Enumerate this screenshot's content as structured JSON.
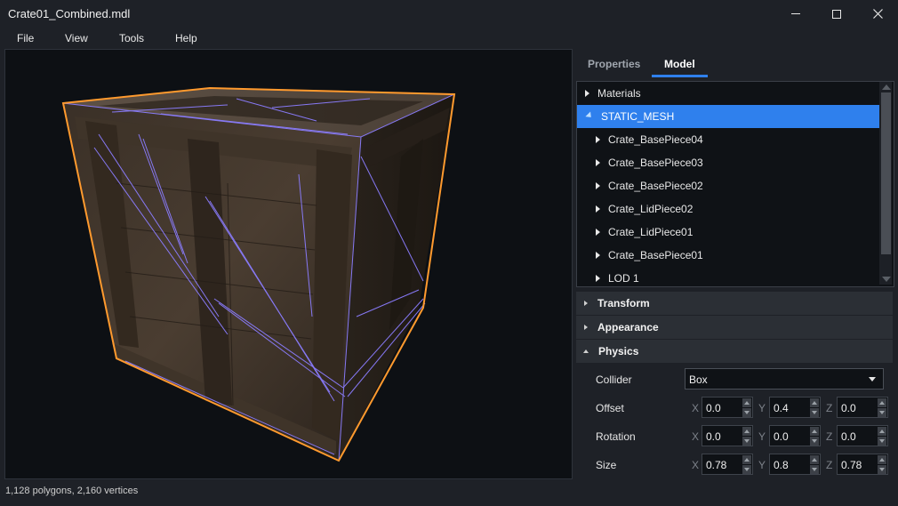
{
  "window": {
    "title": "Crate01_Combined.mdl"
  },
  "menu": [
    "File",
    "View",
    "Tools",
    "Help"
  ],
  "tabs": [
    {
      "label": "Properties",
      "active": false
    },
    {
      "label": "Model",
      "active": true
    }
  ],
  "tree": {
    "items": [
      {
        "label": "Materials",
        "level": 0,
        "expanded": false,
        "selected": false
      },
      {
        "label": "STATIC_MESH",
        "level": 0,
        "expanded": true,
        "selected": true
      },
      {
        "label": "Crate_BasePiece04",
        "level": 1,
        "expanded": false,
        "selected": false
      },
      {
        "label": "Crate_BasePiece03",
        "level": 1,
        "expanded": false,
        "selected": false
      },
      {
        "label": "Crate_BasePiece02",
        "level": 1,
        "expanded": false,
        "selected": false
      },
      {
        "label": "Crate_LidPiece02",
        "level": 1,
        "expanded": false,
        "selected": false
      },
      {
        "label": "Crate_LidPiece01",
        "level": 1,
        "expanded": false,
        "selected": false
      },
      {
        "label": "Crate_BasePiece01",
        "level": 1,
        "expanded": false,
        "selected": false
      },
      {
        "label": "LOD 1",
        "level": 1,
        "expanded": false,
        "selected": false
      }
    ]
  },
  "sections": {
    "transform": {
      "label": "Transform",
      "expanded": false
    },
    "appearance": {
      "label": "Appearance",
      "expanded": false
    },
    "physics": {
      "label": "Physics",
      "expanded": true
    }
  },
  "physics": {
    "collider": {
      "label": "Collider",
      "value": "Box"
    },
    "axes": {
      "x": "X",
      "y": "Y",
      "z": "Z"
    },
    "offset": {
      "label": "Offset",
      "x": "0.0",
      "y": "0.4",
      "z": "0.0"
    },
    "rotation": {
      "label": "Rotation",
      "x": "0.0",
      "y": "0.0",
      "z": "0.0"
    },
    "size": {
      "label": "Size",
      "x": "0.78",
      "y": "0.8",
      "z": "0.78"
    }
  },
  "status": {
    "text": "1,128 polygons, 2,160 vertices"
  },
  "colors": {
    "accent": "#2f80ed",
    "selection_outline": "#ff9a2e",
    "wireframe": "#8b7dff",
    "background": "#1e2127"
  }
}
